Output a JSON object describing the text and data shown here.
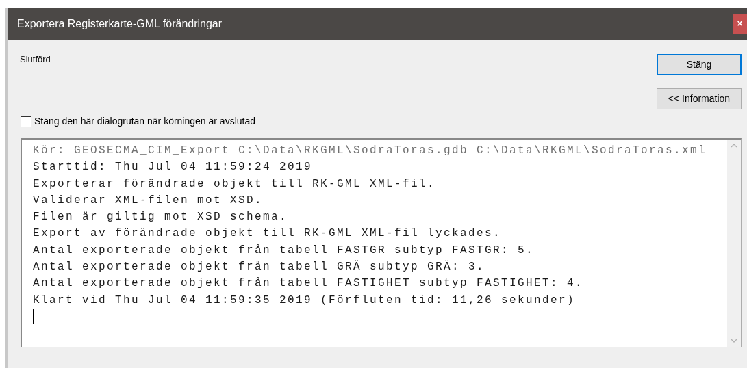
{
  "window": {
    "title": "Exportera Registerkarte-GML förändringar",
    "close": "×"
  },
  "status": "Slutförd",
  "buttons": [
    {
      "label": "Stäng",
      "default": true
    },
    {
      "label": "<< Information",
      "default": false
    }
  ],
  "close_when_done": {
    "label": "Stäng den här dialogrutan när körningen är avslutad",
    "checked": false
  },
  "log": [
    {
      "text": "Kör: GEOSECMA_CIM_Export C:\\Data\\RKGML\\SodraToras.gdb C:\\Data\\RKGML\\SodraToras.xml",
      "dimmed": true
    },
    {
      "text": "Starttid: Thu Jul 04 11:59:24 2019",
      "dimmed": false
    },
    {
      "text": "Exporterar förändrade objekt till RK-GML XML-fil.",
      "dimmed": false
    },
    {
      "text": "Validerar XML-filen mot XSD.",
      "dimmed": false
    },
    {
      "text": "Filen är giltig mot XSD schema.",
      "dimmed": false
    },
    {
      "text": "Export av förändrade objekt till RK-GML XML-fil lyckades.",
      "dimmed": false
    },
    {
      "text": "Antal exporterade objekt från tabell FASTGR subtyp FASTGR: 5.",
      "dimmed": false
    },
    {
      "text": "Antal exporterade objekt från tabell GRÄ subtyp GRÄ: 3.",
      "dimmed": false
    },
    {
      "text": "Antal exporterade objekt från tabell FASTIGHET subtyp FASTIGHET: 4.",
      "dimmed": false
    },
    {
      "text": "Klart vid Thu Jul 04 11:59:35 2019 (Förfluten tid: 11,26 sekunder)",
      "dimmed": false
    }
  ]
}
